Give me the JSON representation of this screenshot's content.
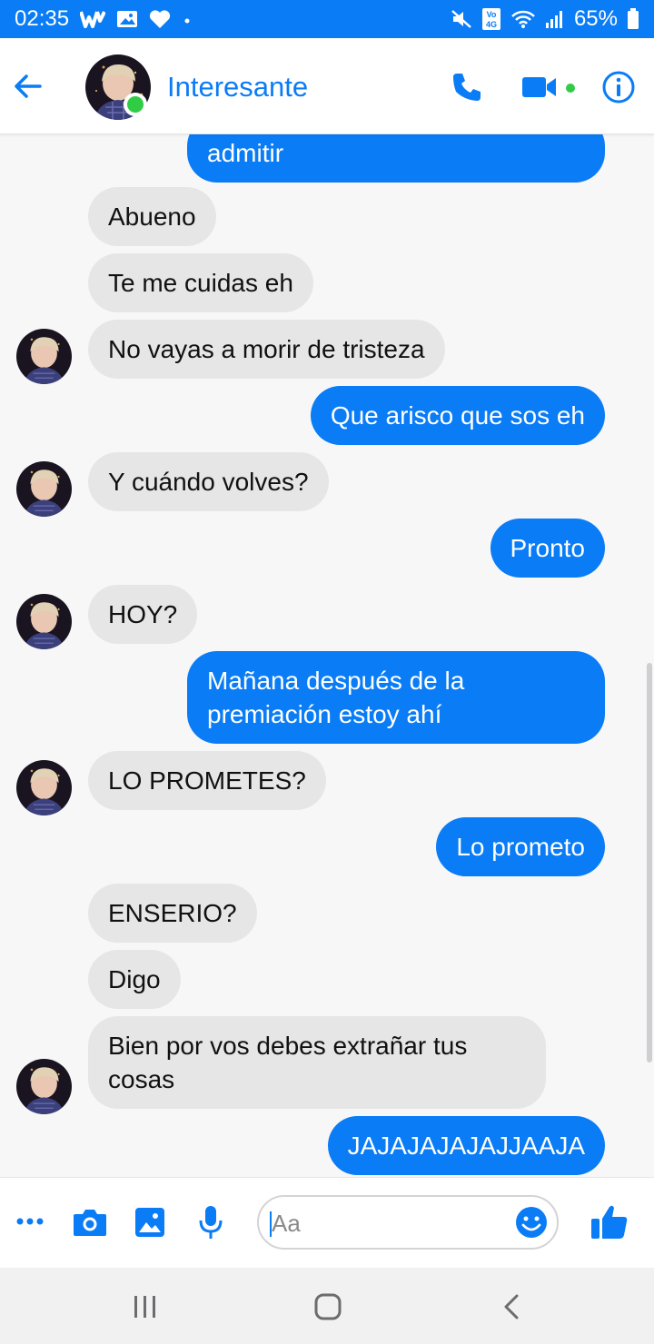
{
  "status_bar": {
    "time": "02:35",
    "battery": "65%",
    "left_icons": [
      "wattpad-icon",
      "image-icon",
      "heart-icon",
      "dot-icon"
    ],
    "right_icons": [
      "mute-icon",
      "volte-icon",
      "wifi-icon",
      "signal-icon",
      "battery-icon"
    ]
  },
  "header": {
    "contact_name": "Interesante",
    "online": true,
    "icons": [
      "back-arrow-icon",
      "phone-icon",
      "video-camera-icon",
      "info-icon"
    ],
    "accent_color": "#0a7cf6",
    "online_color": "#31cc46"
  },
  "messages": [
    {
      "direction": "out",
      "text": "admitir"
    },
    {
      "direction": "in",
      "text": "Abueno"
    },
    {
      "direction": "in",
      "text": "Te me cuidas eh"
    },
    {
      "direction": "in",
      "text": "No vayas a morir de tristeza"
    },
    {
      "direction": "out",
      "text": "Que arisco que sos eh"
    },
    {
      "direction": "in",
      "text": "Y cuándo volves?"
    },
    {
      "direction": "out",
      "text": "Pronto"
    },
    {
      "direction": "in",
      "text": "HOY?"
    },
    {
      "direction": "out",
      "text": "Mañana después de la premiación estoy ahí"
    },
    {
      "direction": "in",
      "text": "LO PROMETES?"
    },
    {
      "direction": "out",
      "text": "Lo prometo"
    },
    {
      "direction": "in",
      "text": "ENSERIO?"
    },
    {
      "direction": "in",
      "text": "Digo"
    },
    {
      "direction": "in",
      "text": "Bien por vos debes extrañar tus cosas"
    },
    {
      "direction": "out",
      "text": "JAJAJAJAJAJJAAJA"
    }
  ],
  "composer": {
    "placeholder": "Aa",
    "icons": [
      "more-icon",
      "camera-icon",
      "gallery-icon",
      "microphone-icon",
      "emoji-icon",
      "thumbs-up-icon"
    ]
  },
  "nav_bar": {
    "icons": [
      "recents-icon",
      "home-icon",
      "back-icon"
    ]
  }
}
